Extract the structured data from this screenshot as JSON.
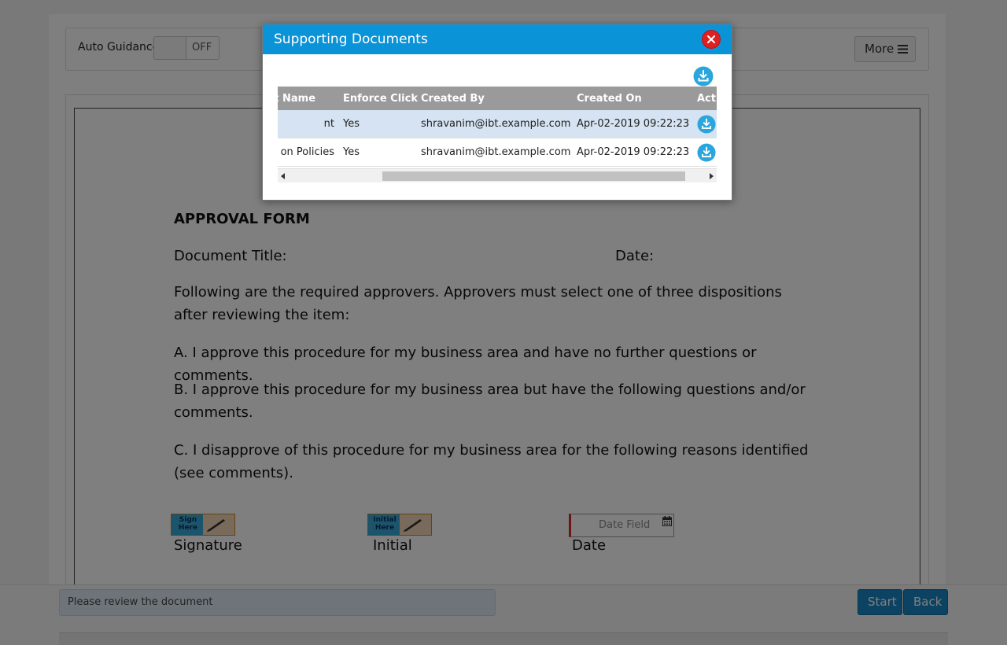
{
  "toolbar": {
    "auto_guidance_label": "Auto Guidance",
    "toggle_state": "OFF",
    "more_label": "More"
  },
  "document": {
    "title": "APPROVAL FORM",
    "doc_title_label": "Document Title:",
    "date_label": "Date:",
    "intro": "Following are the required approvers. Approvers must select one of three dispositions after reviewing the item:",
    "option_a": "A. I approve this procedure for my business area and have no further questions or comments.",
    "option_b": "B. I approve this procedure for my business area but have the following questions and/or comments.",
    "option_c": "C. I disapprove of this procedure for my business area for the following reasons identified (see comments).",
    "sign_here": "Sign Here",
    "initial_here": "Initial Here",
    "signature_label": "Signature",
    "initial_label": "Initial",
    "date_field_placeholder": "Date Field",
    "date_field_label": "Date"
  },
  "footer": {
    "status_text": "Please review the document",
    "start_label": "Start",
    "back_label": "Back"
  },
  "modal": {
    "title": "Supporting Documents",
    "columns": [
      "nt Name",
      "Enforce Click",
      "Created By",
      "Created On",
      "Acti"
    ],
    "rows": [
      {
        "name": "nt",
        "enforce": "Yes",
        "created_by": "shravanim@ibt.example.com",
        "created_on": "Apr-02-2019 09:22:23"
      },
      {
        "name": "on Policies",
        "enforce": "Yes",
        "created_by": "shravanim@ibt.example.com",
        "created_on": "Apr-02-2019 09:22:23"
      }
    ]
  },
  "colors": {
    "header_blue": "#0b93d8",
    "button_blue": "#1b87c4",
    "close_red": "#e02020",
    "selected_row": "#d5e3f2",
    "download_icon": "#2ba6dd"
  },
  "icons": [
    "hamburger-icon",
    "close-icon",
    "download-icon",
    "calendar-icon",
    "pen-icon"
  ]
}
